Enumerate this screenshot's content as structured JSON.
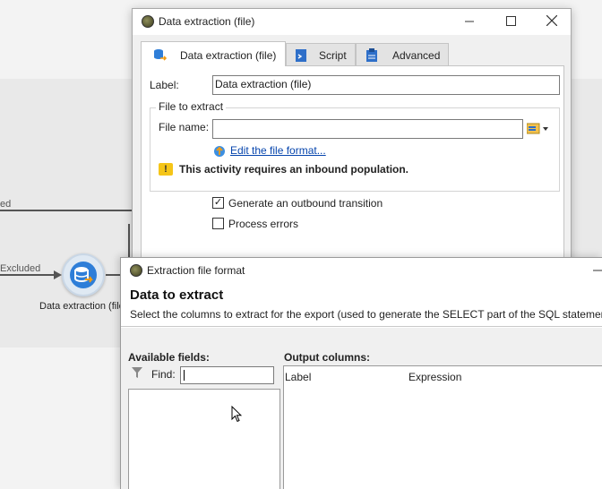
{
  "canvas": {
    "edge_label_top": "ed",
    "edge_label_excluded": "Excluded",
    "node_label": "Data extraction (file"
  },
  "dialog1": {
    "title": "Data extraction (file)",
    "tabs": [
      {
        "label": "Data extraction (file)",
        "icon": "database-icon",
        "active": true
      },
      {
        "label": "Script",
        "icon": "script-icon",
        "active": false
      },
      {
        "label": "Advanced",
        "icon": "clipboard-icon",
        "active": false
      }
    ],
    "label_caption": "Label:",
    "label_value": "Data extraction (file)",
    "file_group_title": "File to extract",
    "file_name_caption": "File name:",
    "file_name_value": "",
    "edit_format_link": "Edit the file format...",
    "warning_text": "This activity requires an inbound population.",
    "warning_color": "#f5c518",
    "generate_outbound": {
      "label": "Generate an outbound transition",
      "checked": true
    },
    "process_errors": {
      "label": "Process errors",
      "checked": false
    }
  },
  "dialog2": {
    "title": "Extraction file format",
    "heading": "Data to extract",
    "description": "Select the columns to extract for the export (used to generate the SELECT part of the SQL statement).",
    "available_fields_title": "Available fields:",
    "find_caption": "Find:",
    "find_value": "",
    "output_columns_title": "Output columns:",
    "output_columns_headers": [
      "Label",
      "Expression"
    ]
  },
  "colors": {
    "link": "#0645ad",
    "node_fill": "#2e7ed8",
    "canvas_bg": "#e9e9e9"
  }
}
